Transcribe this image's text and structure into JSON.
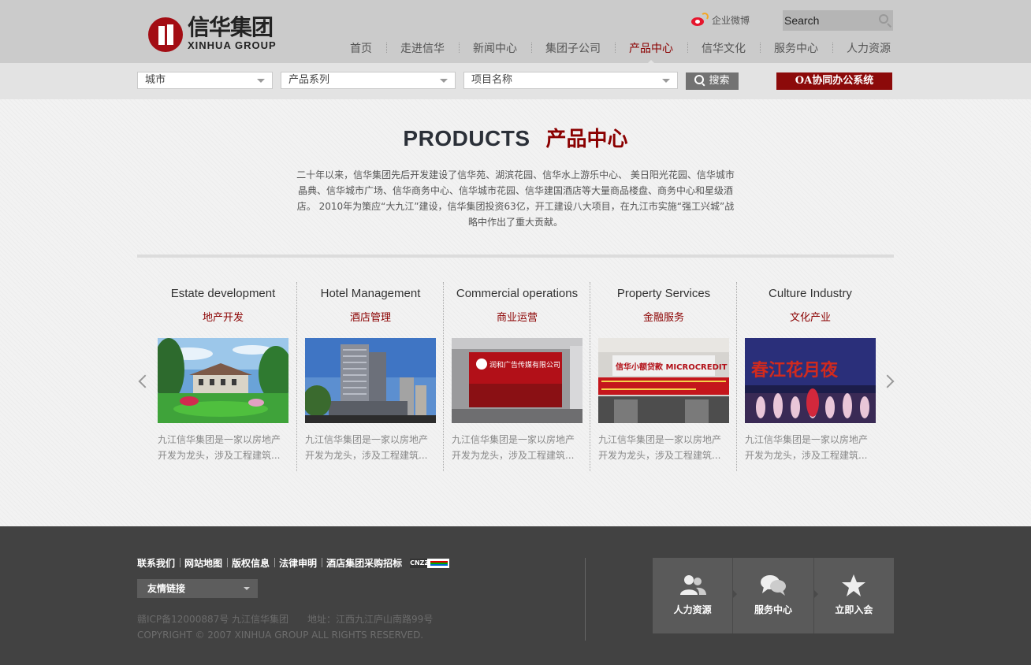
{
  "header": {
    "logo_cn": "信华集团",
    "logo_en": "XINHUA GROUP",
    "weibo_label": "企业微博",
    "search_placeholder": "Search",
    "nav": [
      {
        "label": "首页"
      },
      {
        "label": "走进信华"
      },
      {
        "label": "新闻中心"
      },
      {
        "label": "集团子公司"
      },
      {
        "label": "产品中心",
        "active": true
      },
      {
        "label": "信华文化"
      },
      {
        "label": "服务中心"
      },
      {
        "label": "人力资源"
      }
    ]
  },
  "filters": {
    "city": "城市",
    "series": "产品系列",
    "project": "项目名称",
    "search_button": "搜索",
    "oa_button": "OA协同办公系统"
  },
  "main": {
    "title_en": "PRODUCTS",
    "title_cn": "产品中心",
    "intro": "二十年以来，信华集团先后开发建设了信华苑、湖滨花园、信华水上游乐中心、 美日阳光花园、信华城市晶典、信华城市广场、信华商务中心、信华城市花园、信华建国酒店等大量商品楼盘、商务中心和星级酒店。 2010年为策应“大九江”建设，信华集团投资63亿，开工建设八大项目，在九江市实施“强工兴城”战略中作出了重大贡献。",
    "cards": [
      {
        "title_en": "Estate development",
        "title_cn": "地产开发",
        "desc": "九江信华集团是一家以房地产开发为龙头，涉及工程建筑..."
      },
      {
        "title_en": "Hotel Management",
        "title_cn": "酒店管理",
        "desc": "九江信华集团是一家以房地产开发为龙头，涉及工程建筑..."
      },
      {
        "title_en": "Commercial operations",
        "title_cn": "商业运营",
        "desc": "九江信华集团是一家以房地产开发为龙头，涉及工程建筑..."
      },
      {
        "title_en": "Property Services",
        "title_cn": "金融服务",
        "desc": "九江信华集团是一家以房地产开发为龙头，涉及工程建筑..."
      },
      {
        "title_en": "Culture Industry",
        "title_cn": "文化产业",
        "desc": "九江信华集团是一家以房地产开发为龙头，涉及工程建筑..."
      }
    ],
    "photo_text": {
      "commercial_sign": "润和广告传媒有限公司",
      "finance_sign": "信华小额贷款 MICROCREDIT",
      "culture_banner": "春江花月夜"
    }
  },
  "footer": {
    "links": [
      "联系我们",
      "网站地图",
      "版权信息",
      "法律申明",
      "酒店集团采购招标"
    ],
    "cnzz": "CNZZ",
    "friend_links": "友情链接",
    "icp": "赣ICP备12000887号 九江信华集团　　地址：江西九江庐山南路99号",
    "copyright": "COPYRIGHT © 2007 XINHUA GROUP ALL RIGHTS RESERVED.",
    "quick": [
      {
        "label": "人力资源",
        "icon": "users-icon"
      },
      {
        "label": "服务中心",
        "icon": "chat-icon"
      },
      {
        "label": "立即入会",
        "icon": "star-icon"
      }
    ]
  },
  "colors": {
    "brand": "#8b0000",
    "topbar": "#cbcbcb",
    "footer": "#424242"
  }
}
